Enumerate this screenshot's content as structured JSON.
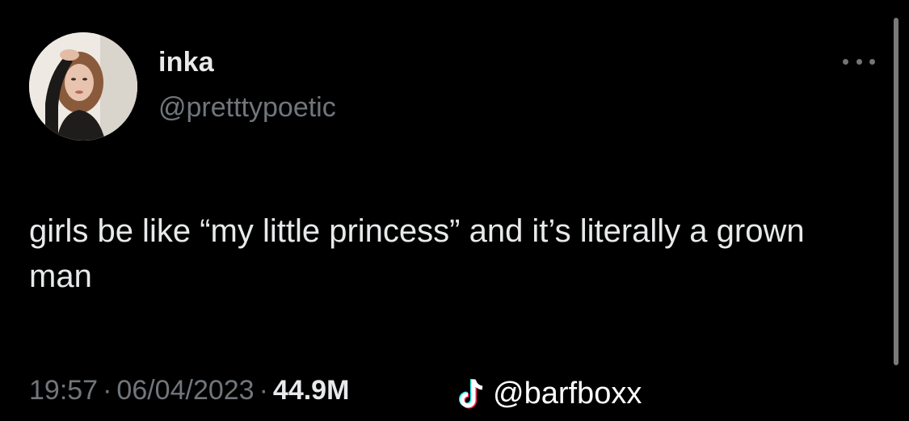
{
  "author": {
    "display_name": "inka",
    "handle": "@pretttypoetic",
    "avatar": "profile-photo"
  },
  "tweet": {
    "text": "girls be like “my little princess” and it’s literally a grown man"
  },
  "meta": {
    "time": "19:57",
    "separator": "·",
    "date": "06/04/2023",
    "views_count": "44.9M"
  },
  "more_icon": "more-horizontal-icon",
  "watermark": {
    "icon": "tiktok-icon",
    "handle": "@barfboxx"
  },
  "colors": {
    "background": "#000000",
    "primary_text": "#e7e9ea",
    "secondary_text": "#71767b"
  }
}
